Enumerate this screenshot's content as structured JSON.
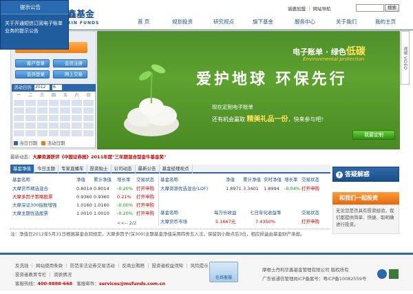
{
  "popup": {
    "title": "提示公告",
    "body": "关于开通短信订阅电子账单业务的提示公告"
  },
  "brand": {
    "name": "鑫基金",
    "sub": "XIN FUNDS"
  },
  "toplinks": {
    "text": "诚邀加盟 ｜ 网站导航",
    "search_btn": "搜索"
  },
  "nav": [
    "首 页",
    "规划投资",
    "研究视点",
    "旗下基金",
    "服务中心",
    "关于我们",
    "我的主页"
  ],
  "left": {
    "open_btn": "开户交易",
    "btns": [
      "客户登录",
      "会员注册",
      "会员登录",
      "网上交易"
    ]
  },
  "calendar": {
    "title": "活动日历",
    "year": "2012",
    "month": "6",
    "weekdays": [
      "一",
      "二",
      "三",
      "四",
      "五",
      "六",
      "日"
    ],
    "legend_today": "当日日期",
    "legend_event": "活动日期"
  },
  "banner": {
    "ebill": "电子账单 · 绿色",
    "lowcarbon": "低碳",
    "ep": "Environmental protection",
    "slogan": "爱护地球  环保先行",
    "sub1": "现在定制电子账单",
    "sub2a": "还有机会赢取 ",
    "sub2b": "精美礼品一份",
    "sub2c": "，快来参与吧!",
    "customize": "我要定制",
    "video": "视频 VIDEO"
  },
  "ticker": {
    "label": "最新动态：",
    "text": "大摩资源获评《中国证券报》2011年度\"三年期混合型金牛基金奖\""
  },
  "tabs": [
    "基金净值",
    "今日主题",
    "专家直播车",
    "投资贴士",
    "公司动态",
    "最新公告",
    "基金经理视点"
  ],
  "table1": {
    "headers": [
      "基金名称",
      "净值",
      "累计净值",
      "增长率",
      "交易状态"
    ],
    "rows": [
      [
        "大摩货币精选混合",
        "0.8014",
        "0.8014",
        "-0.20%",
        "打开申购"
      ],
      [
        "大摩多因子策略股票",
        "0.9360",
        "0.9360",
        "0.21%",
        "打开申购"
      ],
      [
        "大摩深证300指数增强",
        "1.0160",
        "1.0160",
        "-0.00%",
        "打开申购"
      ],
      [
        "大摩主题优选股票",
        "1.0010",
        "1.0010",
        "-0.20%",
        "打开申购"
      ]
    ],
    "pager": "<<-- 2/2"
  },
  "table2": {
    "headers": [
      "基金名称",
      "净值",
      "累计净值",
      "实时净值",
      "增长率",
      "交易状态"
    ],
    "rows": [
      [
        "大摩资源优选混合(LOF)",
        "1.8971",
        "3.3401",
        "1.8994",
        "-0.04%",
        "打开申购"
      ]
    ]
  },
  "table3": {
    "headers": [
      "基金名称",
      "每万份收益",
      "七日年化收益率",
      "交易状态"
    ],
    "rows": [
      [
        "大摩货币市场",
        "5.1667元",
        "7.4350%",
        "打开申购"
      ]
    ]
  },
  "note": "注：净值日2012年5月31日根据基金合同规定，大摩多因子(深300)主题基金净值采用四舍五入法，保留到小数点后3位，相应损益由基金财产承担。",
  "right": {
    "faq": "答疑解惑",
    "invest": "和我们一起投资",
    "text": "无论您是否具有投资经验，我们都提供简单、快捷、取明确进行投资。"
  },
  "footer": {
    "line1": "反洗钱 ｜ 网站使用条款 ｜ 防范非法证券交易活动 ｜ 反商业贿赂 ｜ 投资者权益须知 ｜ 风险提示",
    "line2": "投资者教育专栏 ｜ 资质情况",
    "hotline_label": "客服热线：",
    "hotline": "400-8888-668",
    "mail_label": "客服邮件：",
    "mail": "services@msfunds.com.cn",
    "service": "在线客服",
    "company": "摩根士丹利华鑫基金管理有限公司 版权所有",
    "icp": "广东省通信管理局ICP备案号：粤ICP备10082559号"
  },
  "colors": {
    "blue": "#1c4f8d",
    "green": "#4e8f2a",
    "orange": "#f07c10",
    "red": "#cc0000"
  }
}
